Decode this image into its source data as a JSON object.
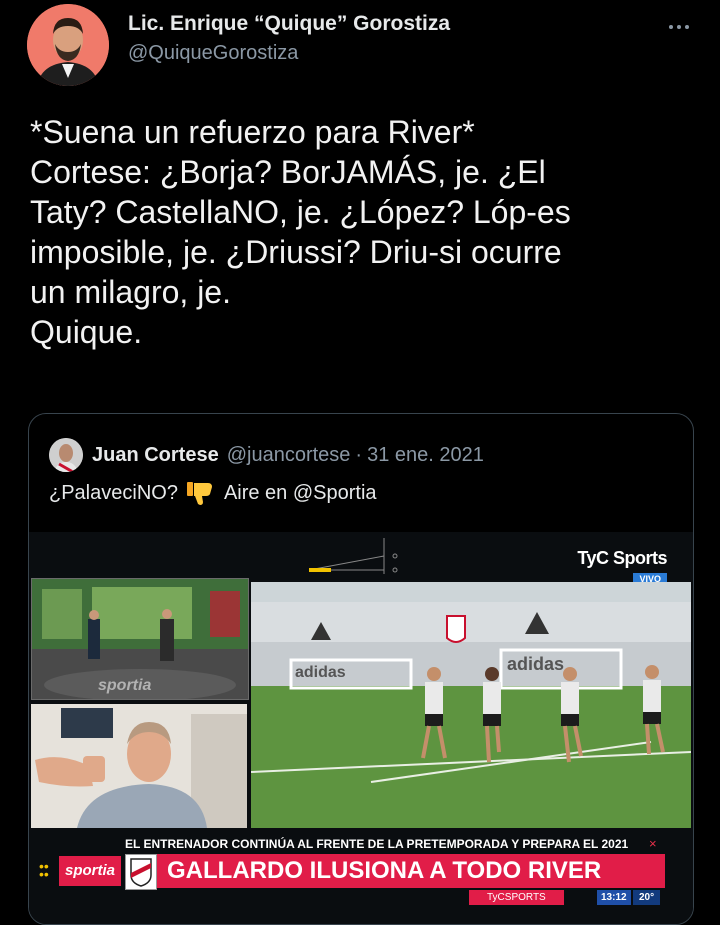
{
  "tweet": {
    "author_name": "Lic. Enrique “Quique” Gorostiza",
    "author_handle": "@QuiqueGorostiza",
    "more_icon": "more-horizontal-icon",
    "text_lines": [
      "*Suena un refuerzo para River*",
      "Cortese: ¿Borja? BorJAMÁS, je. ¿El",
      "Taty? CastellaNO, je. ¿López? Lóp-es",
      "imposible, je. ¿Driussi? Driu-si ocurre",
      "un milagro, je.",
      "Quique."
    ]
  },
  "quote": {
    "author_name": "Juan Cortese",
    "author_handle": "@juancortese",
    "separator": "·",
    "date": "31 ene. 2021",
    "text_before": "¿PalaveciNO?",
    "emoji_icon": "thumbs-down-icon",
    "text_after": "Aire en @Sportia",
    "video": {
      "channel": "TyC Sports",
      "live_badge": "VIVO",
      "studio_brand": "sportia",
      "field_signs": [
        "adidas",
        "adidas"
      ],
      "ticker_top": "EL ENTRENADOR CONTINÚA AL FRENTE DE LA PRETEMPORADA Y PREPARA EL 2021",
      "program_tag": "sportia",
      "headline": "GALLARDO ILUSIONA A TODO RIVER",
      "social_handle": "TyCSPORTS",
      "clock": "13:12",
      "temperature": "20°"
    }
  },
  "colors": {
    "background": "#000000",
    "text": "#e7e9ea",
    "muted": "#8b98a5",
    "border": "#38444d",
    "tyc_red": "#e11d48",
    "avatar_bg": "#f07a6a"
  }
}
